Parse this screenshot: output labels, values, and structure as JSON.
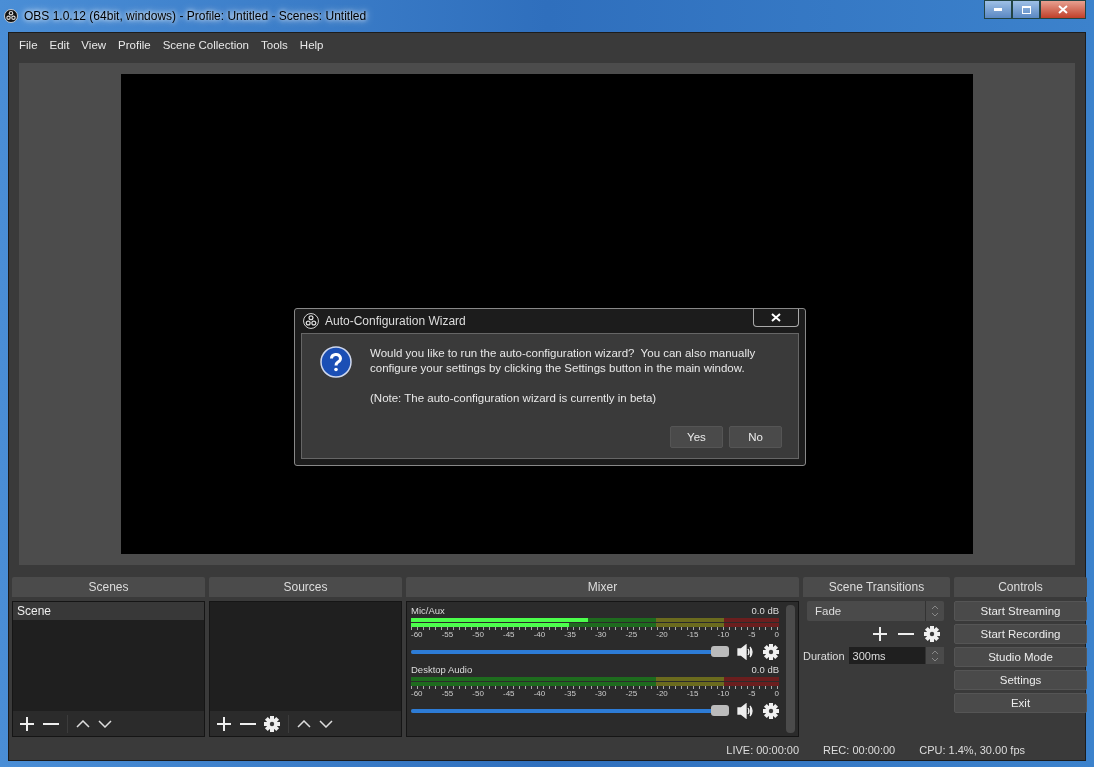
{
  "window": {
    "title": "OBS 1.0.12 (64bit, windows) - Profile: Untitled - Scenes: Untitled"
  },
  "menu": [
    "File",
    "Edit",
    "View",
    "Profile",
    "Scene Collection",
    "Tools",
    "Help"
  ],
  "dialog": {
    "title": "Auto-Configuration Wizard",
    "message": "Would you like to run the auto-configuration wizard?  You can also manually configure your settings by clicking the Settings button in the main window.",
    "note": "(Note: The auto-configuration wizard is currently in beta)",
    "buttons": [
      "Yes",
      "No"
    ]
  },
  "scenes": {
    "title": "Scenes",
    "items": [
      {
        "label": "Scene",
        "selected": true
      }
    ]
  },
  "sources": {
    "title": "Sources"
  },
  "mixer": {
    "title": "Mixer",
    "channels": [
      {
        "name": "Mic/Aux",
        "reading": "0.0 dB",
        "meters": [
          {
            "level": 0.48
          },
          {
            "level": 0.43
          }
        ],
        "volume": {
          "level": 1.0
        },
        "scale": [
          "-60",
          "-55",
          "-50",
          "-45",
          "-40",
          "-35",
          "-30",
          "-25",
          "-20",
          "-15",
          "-10",
          "-5",
          "0"
        ]
      },
      {
        "name": "Desktop Audio",
        "reading": "0.0 dB",
        "meters": [
          {
            "level": 0.0
          },
          {
            "level": 0.0
          }
        ],
        "volume": {
          "level": 1.0
        },
        "scale": [
          "-60",
          "-55",
          "-50",
          "-45",
          "-40",
          "-35",
          "-30",
          "-25",
          "-20",
          "-15",
          "-10",
          "-5",
          "0"
        ]
      }
    ]
  },
  "transitions": {
    "title": "Scene Transitions",
    "transition": "Fade",
    "duration_label": "Duration",
    "duration": "300ms"
  },
  "controls": {
    "title": "Controls",
    "buttons": [
      "Start Streaming",
      "Start Recording",
      "Studio Mode",
      "Settings",
      "Exit"
    ]
  },
  "status_bar": {
    "live": "LIVE: 00:00:00",
    "rec": "REC: 00:00:00",
    "cpu": "CPU: 1.4%, 30.00 fps"
  }
}
